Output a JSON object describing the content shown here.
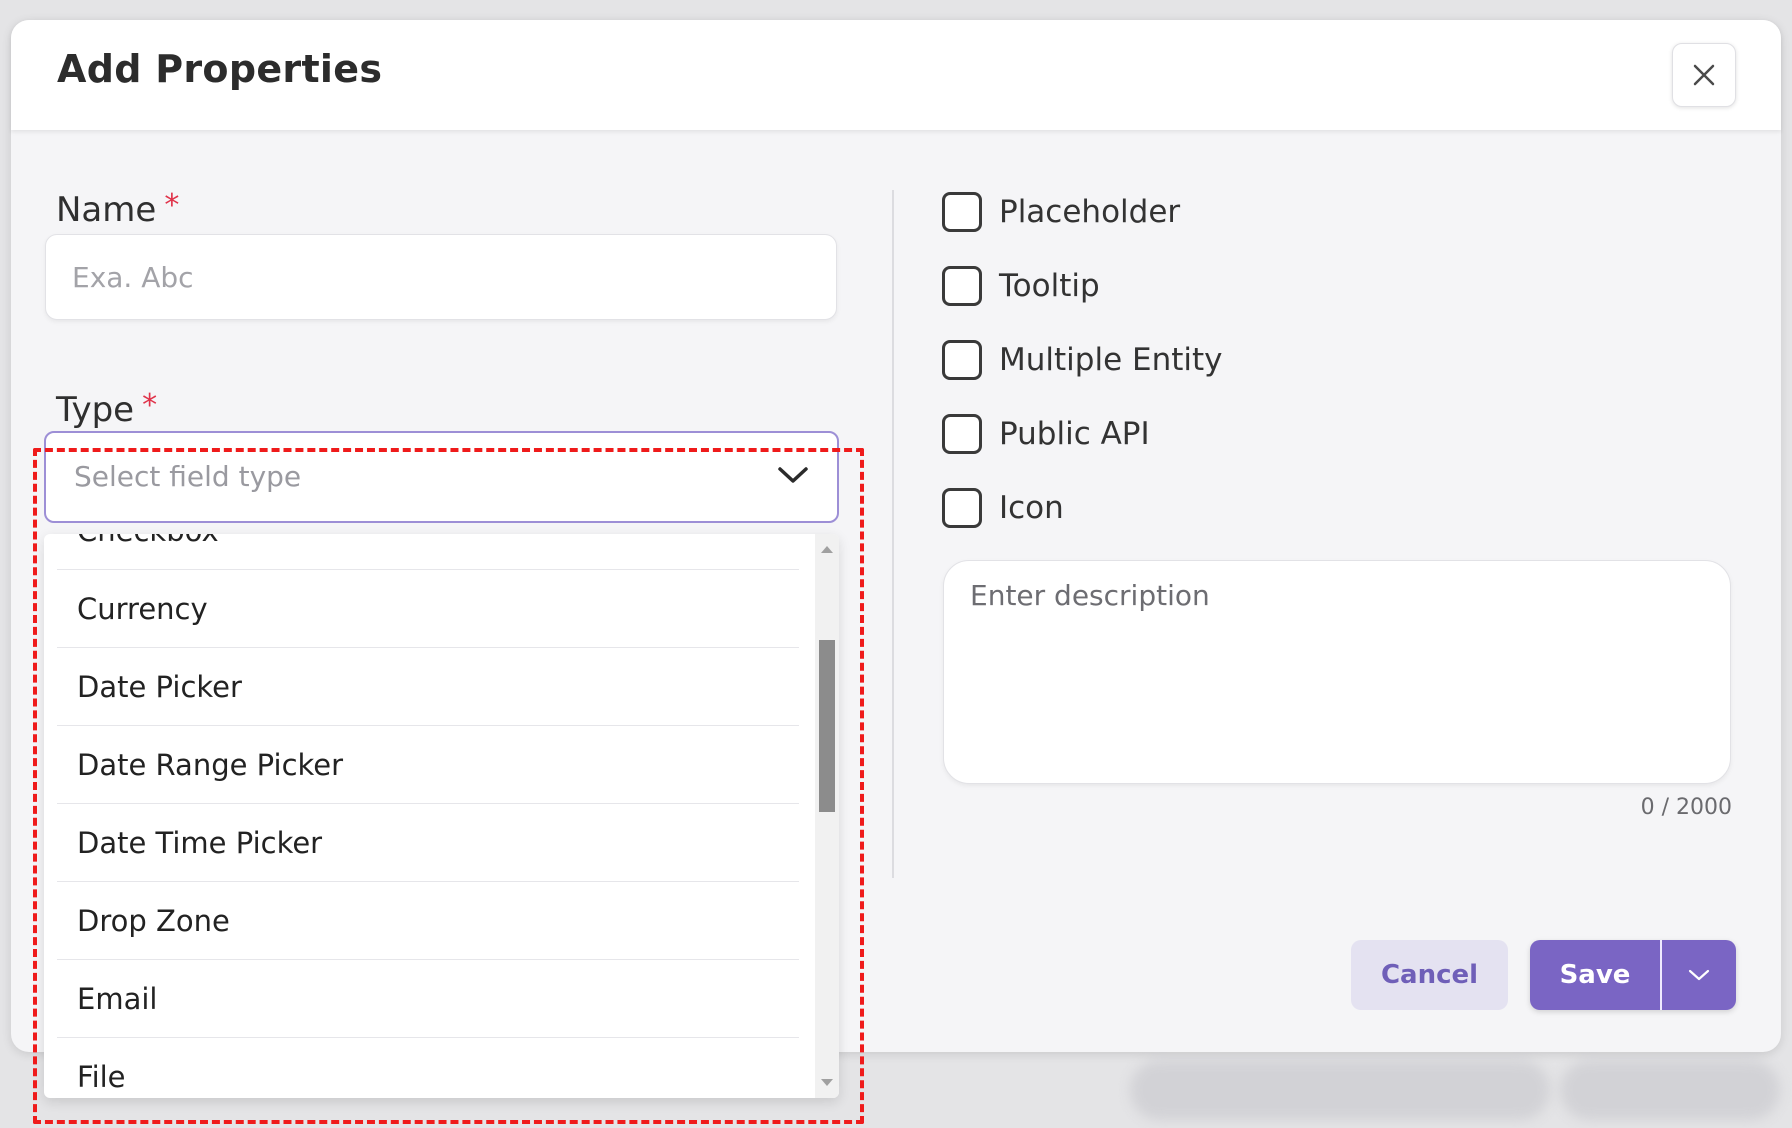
{
  "modal": {
    "title": "Add Properties"
  },
  "form": {
    "name": {
      "label": "Name",
      "required_mark": "*",
      "placeholder": "Exa. Abc",
      "value": ""
    },
    "type": {
      "label": "Type",
      "required_mark": "*",
      "placeholder": "Select field type",
      "options": [
        "Checkbox",
        "Currency",
        "Date Picker",
        "Date Range Picker",
        "Date Time Picker",
        "Drop Zone",
        "Email",
        "File"
      ]
    }
  },
  "options": {
    "checkboxes": [
      {
        "label": "Placeholder",
        "checked": false
      },
      {
        "label": "Tooltip",
        "checked": false
      },
      {
        "label": "Multiple Entity",
        "checked": false
      },
      {
        "label": "Public API",
        "checked": false
      },
      {
        "label": "Icon",
        "checked": false
      }
    ],
    "description": {
      "placeholder": "Enter description",
      "value": "",
      "char_count": "0 / 2000"
    }
  },
  "actions": {
    "cancel_label": "Cancel",
    "save_label": "Save"
  },
  "colors": {
    "accent": "#7a65c4",
    "required": "#e0334a",
    "highlight": "#ef1b1b"
  }
}
